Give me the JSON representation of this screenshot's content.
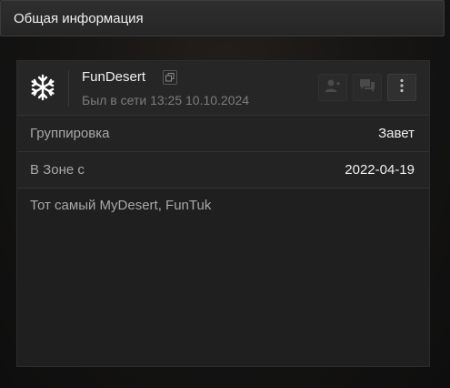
{
  "header": {
    "title": "Общая информация"
  },
  "profile": {
    "name": "FunDesert",
    "status": "Был в сети 13:25 10.10.2024",
    "logo_icon": "snowflake-icon",
    "actions": [
      {
        "icon": "add-friend-icon"
      },
      {
        "icon": "chat-icon"
      },
      {
        "icon": "more-vertical-icon"
      }
    ]
  },
  "info": {
    "group_label": "Группировка",
    "group_value": "Завет",
    "zone_label": "В Зоне с",
    "zone_value": "2022-04-19"
  },
  "description": "Тот самый MyDesert, FunTuk"
}
